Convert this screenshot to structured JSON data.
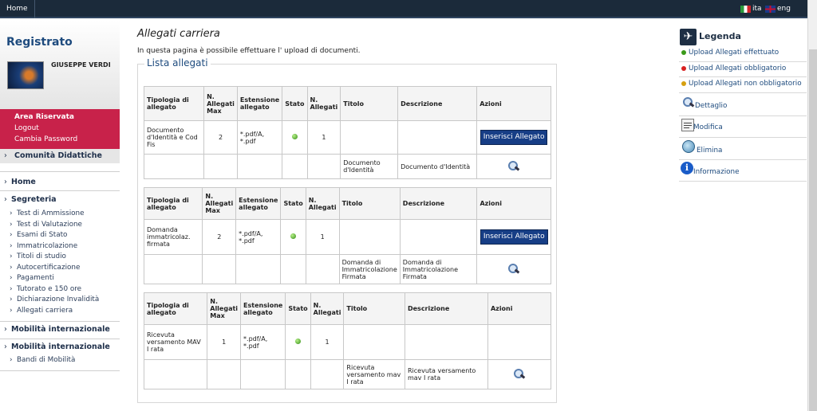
{
  "topbar": {
    "home": "Home",
    "lang_it": "ita",
    "lang_en": "eng"
  },
  "sidebar": {
    "title": "Registrato",
    "user": "GIUSEPPE VERDI",
    "area": {
      "header": "Area Riservata",
      "logout": "Logout",
      "change_password": "Cambia Password"
    },
    "comunita": "Comunità Didattiche",
    "home": "Home",
    "segreteria": "Segreteria",
    "segreteria_items": [
      "Test di Ammissione",
      "Test di Valutazione",
      "Esami di Stato",
      "Immatricolazione",
      "Titoli di studio",
      "Autocertificazione",
      "Pagamenti",
      "Tutorato e 150 ore",
      "Dichiarazione Invalidità",
      "Allegati carriera"
    ],
    "mobilita1": "Mobilità internazionale",
    "mobilita2": "Mobilità internazionale",
    "mobilita_items": [
      "Bandi di Mobilità"
    ]
  },
  "main": {
    "title": "Allegati carriera",
    "description": "In questa pagina è possibile effettuare l' upload di documenti.",
    "list_title": "Lista allegati",
    "headers": {
      "tipologia": "Tipologia di allegato",
      "n_max": "N. Allegati Max",
      "estensione": "Estensione allegato",
      "stato": "Stato",
      "n_allegati": "N. Allegati",
      "titolo": "Titolo",
      "descrizione": "Descrizione",
      "azioni": "Azioni"
    },
    "insert_button": "Inserisci Allegato",
    "tables": [
      {
        "tipologia": "Documento d'Identità e Cod Fis",
        "n_max": "2",
        "estensione": "*.pdf/A, *.pdf",
        "n_allegati": "1",
        "attachment": {
          "titolo": "Documento d'Identità",
          "descrizione": "Documento d'Identità"
        }
      },
      {
        "tipologia": "Domanda immatricolaz. firmata",
        "n_max": "2",
        "estensione": "*.pdf/A, *.pdf",
        "n_allegati": "1",
        "attachment": {
          "titolo": "Domanda di Immatricolazione Firmata",
          "descrizione": "Domanda di Immatricolazione Firmata"
        }
      },
      {
        "tipologia": "Ricevuta versamento MAV I rata",
        "n_max": "1",
        "estensione": "*.pdf/A, *.pdf",
        "n_allegati": "1",
        "attachment": {
          "titolo": "Ricevuta versamento mav I rata",
          "descrizione": "Ricevuta versamento mav I rata"
        }
      }
    ]
  },
  "legend": {
    "title": "Legenda",
    "items": [
      {
        "label": "Upload Allegati effettuato",
        "color": "#3a9a1a"
      },
      {
        "label": "Upload Allegati obbligatorio",
        "color": "#d82020"
      },
      {
        "label": "Upload Allegati non obbligatorio",
        "color": "#d6a010"
      }
    ],
    "actions": [
      {
        "label": "Dettaglio",
        "icon": "magnifier-icon"
      },
      {
        "label": "Modifica",
        "icon": "edit-icon"
      },
      {
        "label": "Elimina",
        "icon": "trash-icon"
      },
      {
        "label": "Informazione",
        "icon": "info-icon"
      }
    ]
  }
}
